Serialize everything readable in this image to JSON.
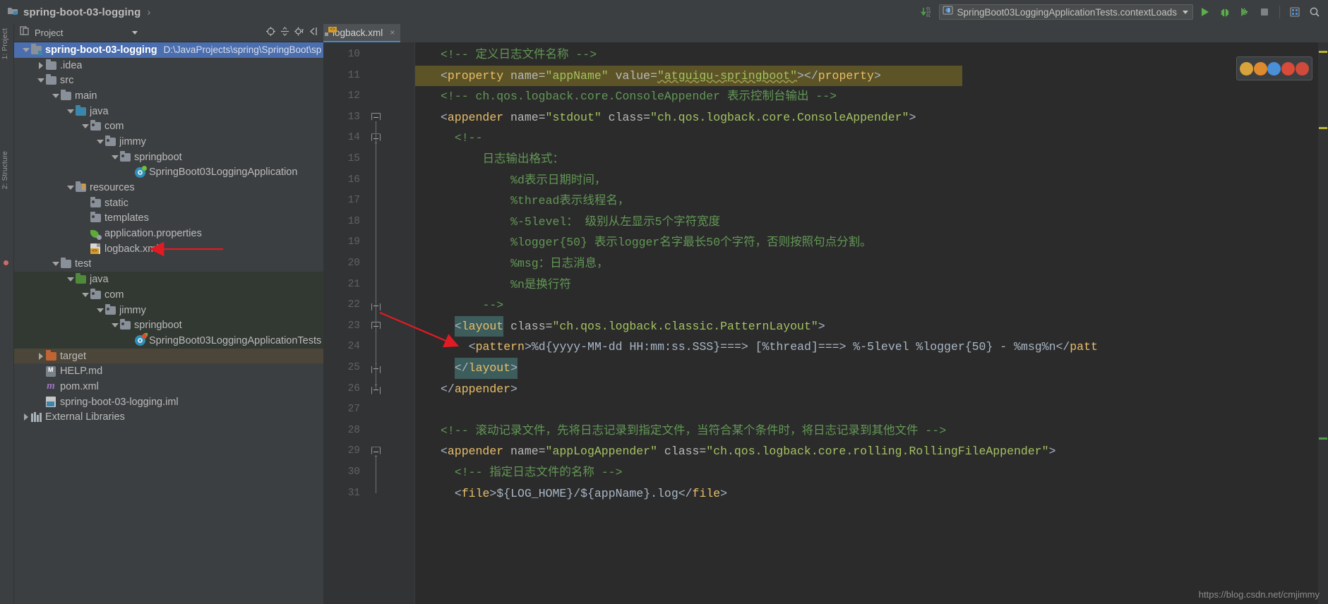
{
  "titlebar": {
    "project_name": "spring-boot-03-logging",
    "project_icon": "module-icon",
    "breadcrumb_chevron": "›",
    "run_config": {
      "icon": "run-config-icon",
      "label": "SpringBoot03LoggingApplicationTests.contextLoads",
      "caret": "▾"
    },
    "buttons": [
      {
        "name": "step-over-icon",
        "glyph": "↴"
      },
      {
        "name": "run-button",
        "glyph": "▶"
      },
      {
        "name": "debug-button",
        "glyph": "ὁE"
      },
      {
        "name": "run-coverage-button",
        "glyph": "▶"
      },
      {
        "name": "stop-button",
        "glyph": "■"
      },
      {
        "name": "database-button",
        "glyph": "▤"
      },
      {
        "name": "search-everywhere-icon",
        "glyph": "⌕"
      }
    ]
  },
  "stripe": {
    "labels": [
      "1: Project",
      "2: Structure"
    ]
  },
  "project_panel": {
    "header_title": "Project",
    "header_icons": [
      "target-icon",
      "collapse-all-icon",
      "settings-icon",
      "hide-icon"
    ],
    "tree": [
      {
        "depth": 0,
        "twisty": "down",
        "icon": "module-icon",
        "label": "spring-boot-03-logging",
        "path": "D:\\JavaProjects\\spring\\SpringBoot\\sp",
        "state": "selected",
        "bold": true
      },
      {
        "depth": 1,
        "twisty": "right",
        "icon": "folder-icon",
        "label": ".idea"
      },
      {
        "depth": 1,
        "twisty": "down",
        "icon": "folder-icon",
        "label": "src"
      },
      {
        "depth": 2,
        "twisty": "down",
        "icon": "folder-icon",
        "label": "main"
      },
      {
        "depth": 3,
        "twisty": "down",
        "icon": "source-root-icon",
        "label": "java"
      },
      {
        "depth": 4,
        "twisty": "down",
        "icon": "package-icon",
        "label": "com"
      },
      {
        "depth": 5,
        "twisty": "down",
        "icon": "package-icon",
        "label": "jimmy"
      },
      {
        "depth": 6,
        "twisty": "down",
        "icon": "package-icon",
        "label": "springboot"
      },
      {
        "depth": 7,
        "twisty": "none",
        "icon": "spring-class-icon",
        "label": "SpringBoot03LoggingApplication"
      },
      {
        "depth": 3,
        "twisty": "down",
        "icon": "resource-root-icon",
        "label": "resources"
      },
      {
        "depth": 4,
        "twisty": "none",
        "icon": "package-icon",
        "label": "static"
      },
      {
        "depth": 4,
        "twisty": "none",
        "icon": "package-icon",
        "label": "templates"
      },
      {
        "depth": 4,
        "twisty": "none",
        "icon": "properties-icon",
        "label": "application.properties"
      },
      {
        "depth": 4,
        "twisty": "none",
        "icon": "xml-icon",
        "label": "logback.xml",
        "annotated": true
      },
      {
        "depth": 2,
        "twisty": "down",
        "icon": "folder-icon",
        "label": "test"
      },
      {
        "depth": 3,
        "twisty": "down",
        "icon": "test-source-root-icon",
        "label": "java",
        "state": "testsrc"
      },
      {
        "depth": 4,
        "twisty": "down",
        "icon": "package-icon",
        "label": "com",
        "state": "testsrc"
      },
      {
        "depth": 5,
        "twisty": "down",
        "icon": "package-icon",
        "label": "jimmy",
        "state": "testsrc"
      },
      {
        "depth": 6,
        "twisty": "down",
        "icon": "package-icon",
        "label": "springboot",
        "state": "testsrc"
      },
      {
        "depth": 7,
        "twisty": "none",
        "icon": "spring-test-icon",
        "label": "SpringBoot03LoggingApplicationTests",
        "state": "testsrc"
      },
      {
        "depth": 1,
        "twisty": "right",
        "icon": "target-folder-icon",
        "label": "target",
        "state": "targetdir"
      },
      {
        "depth": 1,
        "twisty": "none",
        "icon": "md-icon",
        "label": "HELP.md"
      },
      {
        "depth": 1,
        "twisty": "none",
        "icon": "maven-icon",
        "label": "pom.xml"
      },
      {
        "depth": 1,
        "twisty": "none",
        "icon": "iml-icon",
        "label": "spring-boot-03-logging.iml"
      },
      {
        "depth": 0,
        "twisty": "right",
        "icon": "library-icon",
        "label": "External Libraries"
      }
    ]
  },
  "editor": {
    "tabs": [
      {
        "icon": "xml-icon",
        "label": "logback.xml",
        "close": "×",
        "active": true
      }
    ],
    "first_line_number": 10,
    "lines": [
      {
        "n": 10,
        "indent": 0,
        "segments": [
          {
            "cls": "c-cmt",
            "t": "<!-- 定义日志文件名称 -->"
          }
        ]
      },
      {
        "n": 11,
        "indent": 0,
        "highlight": true,
        "fold": "none",
        "segments": [
          {
            "cls": "c-punct",
            "t": "<"
          },
          {
            "cls": "c-tag",
            "t": "property"
          },
          {
            "cls": "c-attr",
            "t": " name="
          },
          {
            "cls": "c-val",
            "t": "\"appName\""
          },
          {
            "cls": "c-attr",
            "t": " value="
          },
          {
            "cls": "c-val wavy",
            "t": "\"atguigu-springboot\""
          },
          {
            "cls": "c-punct",
            "t": "></"
          },
          {
            "cls": "c-tag",
            "t": "property"
          },
          {
            "cls": "c-punct",
            "t": ">"
          }
        ]
      },
      {
        "n": 12,
        "indent": 0,
        "segments": [
          {
            "cls": "c-cmt",
            "t": "<!-- ch.qos.logback.core.ConsoleAppender 表示控制台输出 -->"
          }
        ]
      },
      {
        "n": 13,
        "indent": 0,
        "fold": "start",
        "segments": [
          {
            "cls": "c-punct",
            "t": "<"
          },
          {
            "cls": "c-tag",
            "t": "appender"
          },
          {
            "cls": "c-attr",
            "t": " name="
          },
          {
            "cls": "c-val",
            "t": "\"stdout\""
          },
          {
            "cls": "c-attr",
            "t": " class="
          },
          {
            "cls": "c-val",
            "t": "\"ch.qos.logback.core.ConsoleAppender\""
          },
          {
            "cls": "c-punct",
            "t": ">"
          }
        ]
      },
      {
        "n": 14,
        "indent": 1,
        "fold": "start",
        "segments": [
          {
            "cls": "c-cmt",
            "t": "<!--"
          }
        ]
      },
      {
        "n": 15,
        "indent": 1,
        "segments": [
          {
            "cls": "c-cmt",
            "t": "    日志输出格式："
          }
        ]
      },
      {
        "n": 16,
        "indent": 1,
        "segments": [
          {
            "cls": "c-cmt",
            "t": "        %d表示日期时间，"
          }
        ]
      },
      {
        "n": 17,
        "indent": 1,
        "segments": [
          {
            "cls": "c-cmt",
            "t": "        %thread表示线程名，"
          }
        ]
      },
      {
        "n": 18,
        "indent": 1,
        "segments": [
          {
            "cls": "c-cmt",
            "t": "        %-5level： 级别从左显示5个字符宽度"
          }
        ]
      },
      {
        "n": 19,
        "indent": 1,
        "segments": [
          {
            "cls": "c-cmt",
            "t": "        %logger{50} 表示logger名字最长50个字符，否则按照句点分割。"
          }
        ]
      },
      {
        "n": 20,
        "indent": 1,
        "segments": [
          {
            "cls": "c-cmt",
            "t": "        %msg：日志消息，"
          }
        ]
      },
      {
        "n": 21,
        "indent": 1,
        "segments": [
          {
            "cls": "c-cmt",
            "t": "        %n是换行符"
          }
        ]
      },
      {
        "n": 22,
        "indent": 1,
        "fold": "end",
        "segments": [
          {
            "cls": "c-cmt",
            "t": "    -->"
          }
        ]
      },
      {
        "n": 23,
        "indent": 1,
        "fold": "start",
        "selection": {
          "start": 0,
          "len": 7
        },
        "segments": [
          {
            "cls": "c-punct",
            "t": "<"
          },
          {
            "cls": "c-tag",
            "t": "layout"
          },
          {
            "cls": "c-attr",
            "t": " class="
          },
          {
            "cls": "c-val",
            "t": "\"ch.qos.logback.classic.PatternLayout\""
          },
          {
            "cls": "c-punct",
            "t": ">"
          }
        ]
      },
      {
        "n": 24,
        "indent": 2,
        "annotated": true,
        "segments": [
          {
            "cls": "c-punct",
            "t": "<"
          },
          {
            "cls": "c-tag",
            "t": "pattern"
          },
          {
            "cls": "c-punct",
            "t": ">"
          },
          {
            "cls": "c-txt",
            "t": "%d{yyyy-MM-dd HH:mm:ss.SSS}===> [%thread]===> %-5level %logger{50} - %msg%n"
          },
          {
            "cls": "c-punct",
            "t": "</"
          },
          {
            "cls": "c-tag",
            "t": "patt"
          }
        ]
      },
      {
        "n": 25,
        "indent": 1,
        "fold": "end",
        "selection": {
          "start": 0,
          "len": 9
        },
        "segments": [
          {
            "cls": "c-punct",
            "t": "</"
          },
          {
            "cls": "c-tag",
            "t": "layout"
          },
          {
            "cls": "c-punct",
            "t": ">"
          }
        ]
      },
      {
        "n": 26,
        "indent": 0,
        "fold": "end",
        "segments": [
          {
            "cls": "c-punct",
            "t": "</"
          },
          {
            "cls": "c-tag",
            "t": "appender"
          },
          {
            "cls": "c-punct",
            "t": ">"
          }
        ]
      },
      {
        "n": 27,
        "indent": 0,
        "segments": [
          {
            "cls": "c-txt",
            "t": ""
          }
        ]
      },
      {
        "n": 28,
        "indent": 0,
        "segments": [
          {
            "cls": "c-cmt",
            "t": "<!-- 滚动记录文件，先将日志记录到指定文件，当符合某个条件时，将日志记录到其他文件 -->"
          }
        ]
      },
      {
        "n": 29,
        "indent": 0,
        "fold": "start",
        "segments": [
          {
            "cls": "c-punct",
            "t": "<"
          },
          {
            "cls": "c-tag",
            "t": "appender"
          },
          {
            "cls": "c-attr",
            "t": " name="
          },
          {
            "cls": "c-val",
            "t": "\"appLogAppender\""
          },
          {
            "cls": "c-attr",
            "t": " class="
          },
          {
            "cls": "c-val",
            "t": "\"ch.qos.logback.core.rolling.RollingFileAppender\""
          },
          {
            "cls": "c-punct",
            "t": ">"
          }
        ]
      },
      {
        "n": 30,
        "indent": 1,
        "segments": [
          {
            "cls": "c-cmt",
            "t": "<!-- 指定日志文件的名称 -->"
          }
        ]
      },
      {
        "n": 31,
        "indent": 1,
        "segments": [
          {
            "cls": "c-punct",
            "t": "<"
          },
          {
            "cls": "c-tag",
            "t": "file"
          },
          {
            "cls": "c-punct",
            "t": ">"
          },
          {
            "cls": "c-txt",
            "t": "${LOG_HOME}/${appName}.log"
          },
          {
            "cls": "c-punct",
            "t": "</"
          },
          {
            "cls": "c-tag",
            "t": "file"
          },
          {
            "cls": "c-punct",
            "t": ">"
          }
        ]
      }
    ],
    "inspection_popup": {
      "name": "inspection-widget",
      "bubbles": [
        "#d8a33a",
        "#e08a2e",
        "#4a90d9",
        "#d84a3a",
        "#cf4a3a"
      ]
    }
  },
  "watermark": "https://blog.csdn.net/cmjimmy",
  "colors": {
    "accent": "#4b6eaf",
    "editor_bg": "#2b2b2b",
    "panel_bg": "#3c3f41",
    "comment": "#629755",
    "tag": "#e8bf6a",
    "value": "#a5c261",
    "text": "#a9b7c6",
    "highlight_line": "#5c5327",
    "selection": "#3d5d5c",
    "test_source": "#323832",
    "target_dir": "#4b4639",
    "annotation_arrow": "#e01b24"
  }
}
